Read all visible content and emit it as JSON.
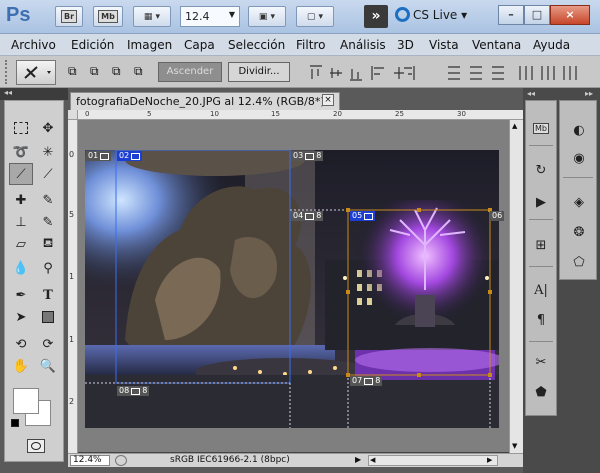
{
  "app": {
    "logo": "Ps",
    "ws_logo": "CS Live",
    "zoom_level": "12.4"
  },
  "titlebar": {
    "bridge": "Br",
    "minibridge": "Mb",
    "min": "–",
    "max": "□",
    "close": "×"
  },
  "menu": [
    "Archivo",
    "Edición",
    "Imagen",
    "Capa",
    "Selección",
    "Filtro",
    "Análisis",
    "3D",
    "Vista",
    "Ventana",
    "Ayuda"
  ],
  "options": {
    "ascender": "Ascender",
    "dividir": "Dividir..."
  },
  "document": {
    "tab_title": "fotografiaDeNoche_20.JPG al 12.4% (RGB/8*) *",
    "tab_close": "×",
    "status_zoom": "12.4%",
    "status_profile": "sRGB IEC61966-2.1 (8bpc)"
  },
  "ruler": {
    "top": [
      "0",
      "5",
      "10",
      "15",
      "20",
      "25",
      "30"
    ],
    "left": [
      "0",
      "5",
      "1",
      "1",
      "2"
    ]
  },
  "slices": [
    "01",
    "02",
    "03",
    "04",
    "05",
    "06",
    "07",
    "08"
  ]
}
